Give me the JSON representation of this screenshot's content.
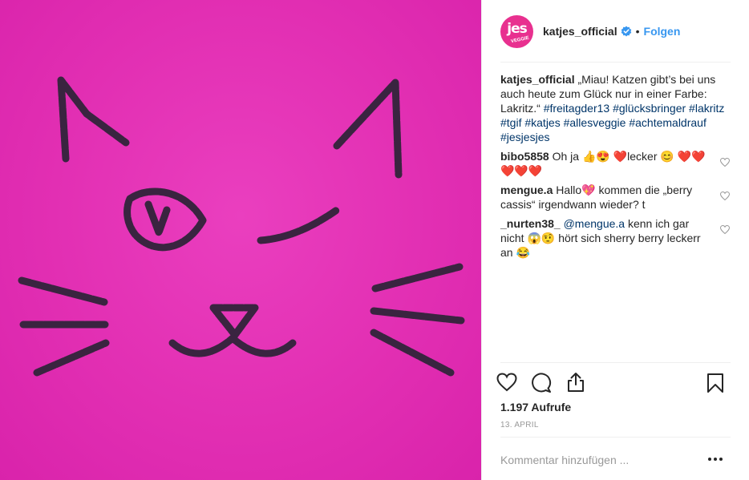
{
  "account": {
    "avatar_text": "jes",
    "avatar_sub": "VEGGIE",
    "username": "katjes_official",
    "separator": "•",
    "follow_label": "Folgen"
  },
  "caption": {
    "user": "katjes_official",
    "text": " „Miau! Katzen gibt’s bei uns auch heute zum Glück nur in einer Farbe: Lakritz.“ ",
    "hashtags": [
      "#freitagder13",
      "#glücksbringer",
      "#lakritz",
      "#tgif",
      "#katjes",
      "#allesveggie",
      "#achtemaldrauf",
      "#jesjesjes"
    ]
  },
  "comments": [
    {
      "user": "bibo5858",
      "text": "Oh ja 👍😍 ❤️lecker 😊 ❤️❤️❤️❤️❤️"
    },
    {
      "user": "mengue.a",
      "text": "Hallo💖 kommen die „berry cassis“ irgendwann wieder? t"
    },
    {
      "user": "_nurten38_",
      "mention": "@mengue.a",
      "text": " kenn ich gar nicht 😱🤨 hört sich sherry berry leckerr an 😂"
    }
  ],
  "stats": {
    "views": "1.197 Aufrufe",
    "date": "13. APRIL"
  },
  "comment_box": {
    "placeholder": "Kommentar hinzufügen ..."
  },
  "colors": {
    "media_background": "#e22fb3",
    "licorice": "#3a2440",
    "link_blue": "#3897f0",
    "hashtag_blue": "#003569",
    "avatar_pink": "#e8308f"
  },
  "icons": [
    "verified-badge-icon",
    "heart-icon",
    "comment-icon",
    "share-icon",
    "bookmark-icon",
    "more-options-icon"
  ]
}
